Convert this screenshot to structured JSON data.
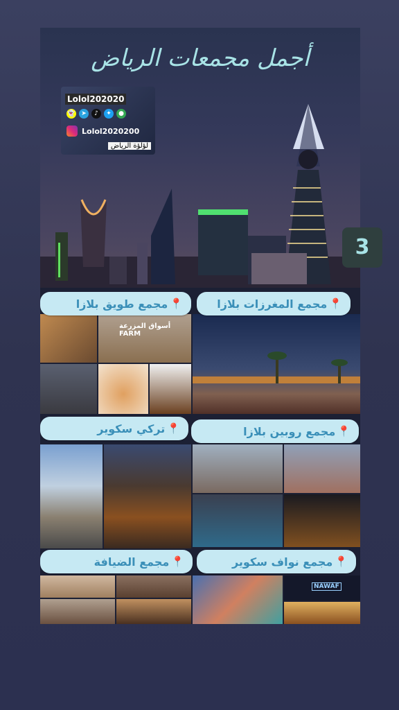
{
  "header": {
    "title": "أجمل مجمعات الرياض",
    "page_number": "3"
  },
  "social": {
    "username_top": "Lolol202020",
    "username_instagram": "Lolol2020200",
    "brand_label": "لؤلؤة الرياض"
  },
  "malls": [
    {
      "name": "مجمع المغرزات بلازا"
    },
    {
      "name": "مجمع طويق بلازا"
    },
    {
      "name": "مجمع روبين بلازا"
    },
    {
      "name": "تركي سكوير"
    },
    {
      "name": "مجمع نواف سكوير"
    },
    {
      "name": "مجمع الضيافة"
    }
  ],
  "photo_texts": {
    "farm_sign": "أسواق المزرعة",
    "farm_sign_en": "FARM",
    "nawaf_sign": "NAWAF"
  },
  "colors": {
    "title": "#a8e3e6",
    "pill_bg": "#c6e9f3",
    "pill_text": "#3a8fb8",
    "pin": "#e03a3a"
  }
}
